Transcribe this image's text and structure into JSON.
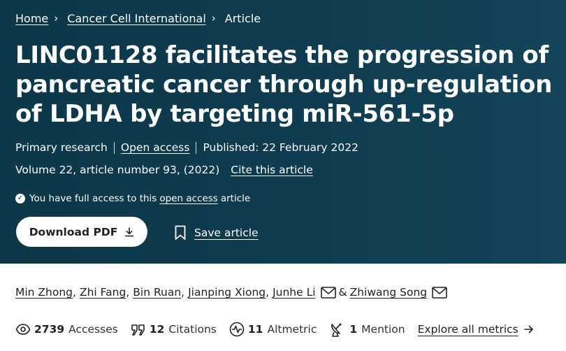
{
  "breadcrumb": {
    "items": [
      {
        "label": "Home"
      },
      {
        "label": "Cancer Cell International"
      },
      {
        "label": "Article"
      }
    ],
    "separator": "›"
  },
  "article": {
    "title": "LINC01128 facilitates the progression of pancreatic cancer through up-regulation of LDHA by targeting miR-561-5p",
    "article_type": "Primary research",
    "open_access_label": "Open access",
    "published": "Published: 22 February 2022",
    "volume_info": "Volume 22, article number 93, (2022)",
    "cite_label": "Cite this article"
  },
  "access": {
    "prefix": "You have full access to this",
    "link": "open access",
    "suffix": "article"
  },
  "actions": {
    "download_label": "Download PDF",
    "save_label": "Save article"
  },
  "authors": {
    "list": [
      "Min Zhong",
      "Zhi Fang",
      "Bin Ruan",
      "Jianping Xiong",
      "Junhe Li",
      "Zhiwang Song"
    ],
    "ampersand": "&"
  },
  "metrics": {
    "accesses": {
      "value": "2739",
      "label": "Accesses"
    },
    "citations": {
      "value": "12",
      "label": "Citations"
    },
    "altmetric": {
      "value": "11",
      "label": "Altmetric"
    },
    "mentions": {
      "value": "1",
      "label": "Mention"
    },
    "explore_label": "Explore all metrics"
  },
  "colors": {
    "hero_background": "#0f3c4f",
    "text_on_dark": "#ffffff",
    "body_text": "#222222"
  },
  "icons": [
    "chevron-right-icon",
    "check-circle-icon",
    "download-icon",
    "bookmark-icon",
    "mail-icon",
    "eye-icon",
    "citation-icon",
    "altmetric-icon",
    "satellite-dish-icon",
    "arrow-right-icon"
  ]
}
